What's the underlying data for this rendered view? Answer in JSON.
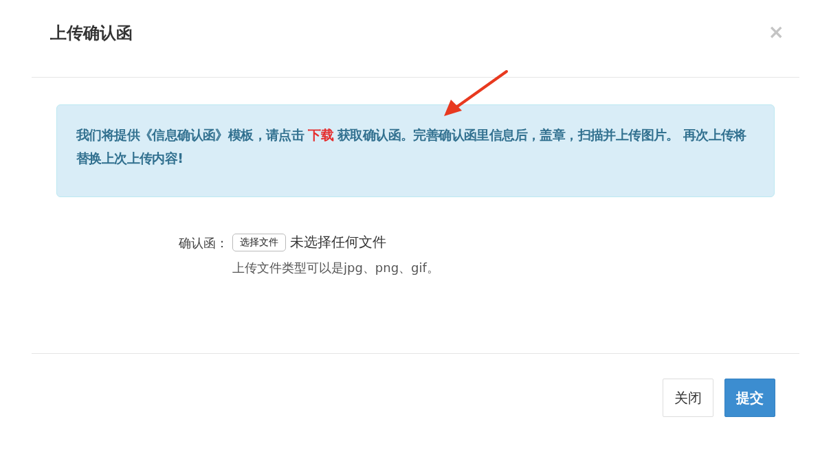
{
  "dialog": {
    "title": "上传确认函",
    "close": "×"
  },
  "notice": {
    "before": "我们将提供《信息确认函》模板，请点击 ",
    "link": "下载",
    "after": " 获取确认函。完善确认函里信息后，盖章，扫描并上传图片。 再次上传将替换上次上传内容!"
  },
  "form": {
    "label": "确认函：",
    "file_button": "选择文件",
    "file_status": "未选择任何文件",
    "hint": "上传文件类型可以是jpg、png、gif。"
  },
  "buttons": [
    {
      "label": "关闭",
      "kind": "default"
    },
    {
      "label": "提交",
      "kind": "primary"
    }
  ]
}
